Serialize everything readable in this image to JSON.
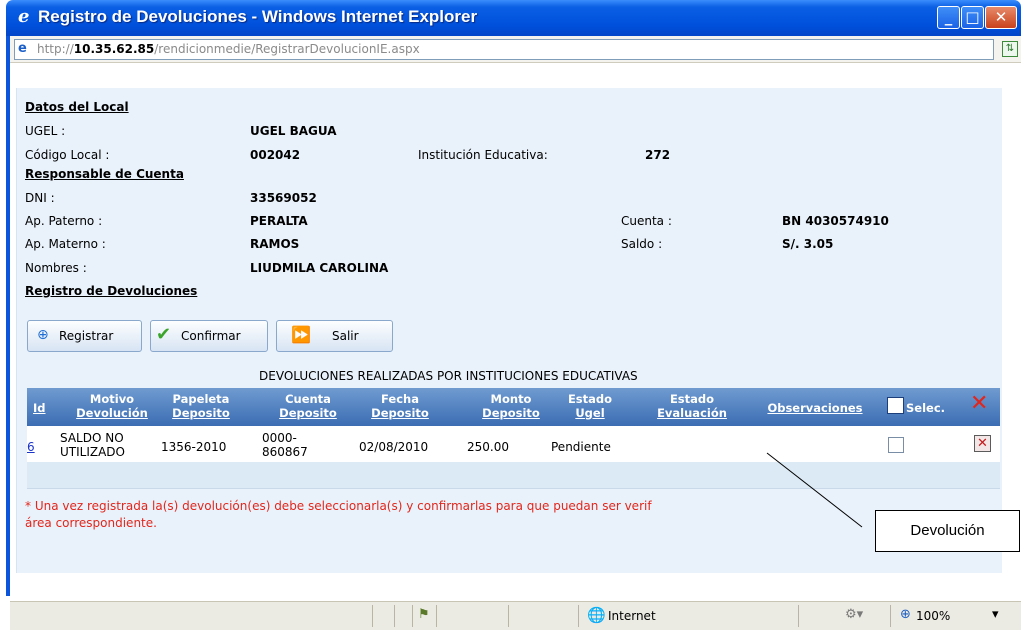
{
  "window": {
    "title": "Registro de Devoluciones - Windows Internet Explorer",
    "url_prefix": "http://",
    "url_host": "10.35.62.85",
    "url_path": "/rendicionmedie/RegistrarDevolucionIE.aspx"
  },
  "datos_local": {
    "heading": "Datos del Local",
    "ugel_label": "UGEL :",
    "ugel_value": "UGEL BAGUA",
    "codigo_label": "Código Local :",
    "codigo_value": "002042",
    "institucion_label": "Institución Educativa:",
    "institucion_value": "272"
  },
  "responsable": {
    "heading": "Responsable de Cuenta",
    "dni_label": "DNI :",
    "dni_value": "33569052",
    "paterno_label": "Ap. Paterno :",
    "paterno_value": "PERALTA",
    "materno_label": "Ap. Materno :",
    "materno_value": "RAMOS",
    "nombres_label": "Nombres :",
    "nombres_value": "LIUDMILA CAROLINA",
    "cuenta_label": "Cuenta :",
    "cuenta_value": "BN 4030574910",
    "saldo_label": "Saldo :",
    "saldo_value": "S/. 3.05"
  },
  "registro_heading": "Registro de Devoluciones",
  "buttons": {
    "registrar": "Registrar",
    "confirmar": "Confirmar",
    "salir": "Salir"
  },
  "grid": {
    "caption": "DEVOLUCIONES REALIZADAS POR INSTITUCIONES EDUCATIVAS",
    "headers": {
      "id": "Id",
      "motivo_1": "Motivo",
      "motivo_2": "Devolución",
      "papeleta_1": "Papeleta",
      "papeleta_2": "Deposito",
      "cuenta_1": "Cuenta",
      "cuenta_2": "Deposito",
      "fecha_1": "Fecha",
      "fecha_2": "Deposito",
      "monto_1": "Monto",
      "monto_2": "Deposito",
      "estado_ugel_1": "Estado",
      "estado_ugel_2": "Ugel",
      "estado_eval_1": "Estado",
      "estado_eval_2": "Evaluación",
      "observaciones": "Observaciones",
      "selec": "Selec."
    },
    "rows": [
      {
        "id": "6",
        "motivo_1": "SALDO NO",
        "motivo_2": "UTILIZADO",
        "papeleta": "1356-2010",
        "cuenta_1": "0000-",
        "cuenta_2": "860867",
        "fecha": "02/08/2010",
        "monto": "250.00",
        "estado_ugel": "Pendiente",
        "estado_evaluacion": "",
        "observaciones": ""
      }
    ]
  },
  "note": {
    "line1": "* Una vez registrada la(s) devolución(es) debe seleccionarla(s) y confirmarlas para que puedan ser verif",
    "line2": "área correspondiente."
  },
  "callout": "Devolución",
  "status": {
    "zone": "Internet",
    "zoom": "100%"
  },
  "icons": {
    "title": "ie-logo-icon",
    "accent": "#0a55db",
    "header_bg": "#3c6db3",
    "error_red": "#e3261b"
  }
}
